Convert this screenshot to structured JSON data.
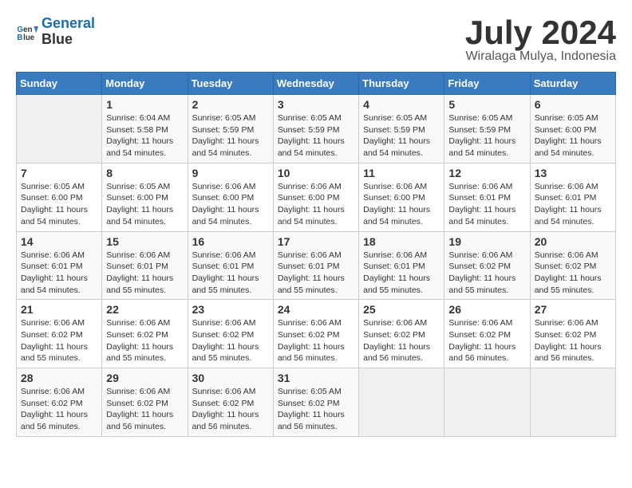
{
  "header": {
    "logo_line1": "General",
    "logo_line2": "Blue",
    "title": "July 2024",
    "subtitle": "Wiralaga Mulya, Indonesia"
  },
  "days_of_week": [
    "Sunday",
    "Monday",
    "Tuesday",
    "Wednesday",
    "Thursday",
    "Friday",
    "Saturday"
  ],
  "weeks": [
    [
      {
        "day": "",
        "info": ""
      },
      {
        "day": "1",
        "info": "Sunrise: 6:04 AM\nSunset: 5:58 PM\nDaylight: 11 hours\nand 54 minutes."
      },
      {
        "day": "2",
        "info": "Sunrise: 6:05 AM\nSunset: 5:59 PM\nDaylight: 11 hours\nand 54 minutes."
      },
      {
        "day": "3",
        "info": "Sunrise: 6:05 AM\nSunset: 5:59 PM\nDaylight: 11 hours\nand 54 minutes."
      },
      {
        "day": "4",
        "info": "Sunrise: 6:05 AM\nSunset: 5:59 PM\nDaylight: 11 hours\nand 54 minutes."
      },
      {
        "day": "5",
        "info": "Sunrise: 6:05 AM\nSunset: 5:59 PM\nDaylight: 11 hours\nand 54 minutes."
      },
      {
        "day": "6",
        "info": "Sunrise: 6:05 AM\nSunset: 6:00 PM\nDaylight: 11 hours\nand 54 minutes."
      }
    ],
    [
      {
        "day": "7",
        "info": "Sunrise: 6:05 AM\nSunset: 6:00 PM\nDaylight: 11 hours\nand 54 minutes."
      },
      {
        "day": "8",
        "info": "Sunrise: 6:05 AM\nSunset: 6:00 PM\nDaylight: 11 hours\nand 54 minutes."
      },
      {
        "day": "9",
        "info": "Sunrise: 6:06 AM\nSunset: 6:00 PM\nDaylight: 11 hours\nand 54 minutes."
      },
      {
        "day": "10",
        "info": "Sunrise: 6:06 AM\nSunset: 6:00 PM\nDaylight: 11 hours\nand 54 minutes."
      },
      {
        "day": "11",
        "info": "Sunrise: 6:06 AM\nSunset: 6:00 PM\nDaylight: 11 hours\nand 54 minutes."
      },
      {
        "day": "12",
        "info": "Sunrise: 6:06 AM\nSunset: 6:01 PM\nDaylight: 11 hours\nand 54 minutes."
      },
      {
        "day": "13",
        "info": "Sunrise: 6:06 AM\nSunset: 6:01 PM\nDaylight: 11 hours\nand 54 minutes."
      }
    ],
    [
      {
        "day": "14",
        "info": "Sunrise: 6:06 AM\nSunset: 6:01 PM\nDaylight: 11 hours\nand 54 minutes."
      },
      {
        "day": "15",
        "info": "Sunrise: 6:06 AM\nSunset: 6:01 PM\nDaylight: 11 hours\nand 55 minutes."
      },
      {
        "day": "16",
        "info": "Sunrise: 6:06 AM\nSunset: 6:01 PM\nDaylight: 11 hours\nand 55 minutes."
      },
      {
        "day": "17",
        "info": "Sunrise: 6:06 AM\nSunset: 6:01 PM\nDaylight: 11 hours\nand 55 minutes."
      },
      {
        "day": "18",
        "info": "Sunrise: 6:06 AM\nSunset: 6:01 PM\nDaylight: 11 hours\nand 55 minutes."
      },
      {
        "day": "19",
        "info": "Sunrise: 6:06 AM\nSunset: 6:02 PM\nDaylight: 11 hours\nand 55 minutes."
      },
      {
        "day": "20",
        "info": "Sunrise: 6:06 AM\nSunset: 6:02 PM\nDaylight: 11 hours\nand 55 minutes."
      }
    ],
    [
      {
        "day": "21",
        "info": "Sunrise: 6:06 AM\nSunset: 6:02 PM\nDaylight: 11 hours\nand 55 minutes."
      },
      {
        "day": "22",
        "info": "Sunrise: 6:06 AM\nSunset: 6:02 PM\nDaylight: 11 hours\nand 55 minutes."
      },
      {
        "day": "23",
        "info": "Sunrise: 6:06 AM\nSunset: 6:02 PM\nDaylight: 11 hours\nand 55 minutes."
      },
      {
        "day": "24",
        "info": "Sunrise: 6:06 AM\nSunset: 6:02 PM\nDaylight: 11 hours\nand 56 minutes."
      },
      {
        "day": "25",
        "info": "Sunrise: 6:06 AM\nSunset: 6:02 PM\nDaylight: 11 hours\nand 56 minutes."
      },
      {
        "day": "26",
        "info": "Sunrise: 6:06 AM\nSunset: 6:02 PM\nDaylight: 11 hours\nand 56 minutes."
      },
      {
        "day": "27",
        "info": "Sunrise: 6:06 AM\nSunset: 6:02 PM\nDaylight: 11 hours\nand 56 minutes."
      }
    ],
    [
      {
        "day": "28",
        "info": "Sunrise: 6:06 AM\nSunset: 6:02 PM\nDaylight: 11 hours\nand 56 minutes."
      },
      {
        "day": "29",
        "info": "Sunrise: 6:06 AM\nSunset: 6:02 PM\nDaylight: 11 hours\nand 56 minutes."
      },
      {
        "day": "30",
        "info": "Sunrise: 6:06 AM\nSunset: 6:02 PM\nDaylight: 11 hours\nand 56 minutes."
      },
      {
        "day": "31",
        "info": "Sunrise: 6:05 AM\nSunset: 6:02 PM\nDaylight: 11 hours\nand 56 minutes."
      },
      {
        "day": "",
        "info": ""
      },
      {
        "day": "",
        "info": ""
      },
      {
        "day": "",
        "info": ""
      }
    ]
  ]
}
